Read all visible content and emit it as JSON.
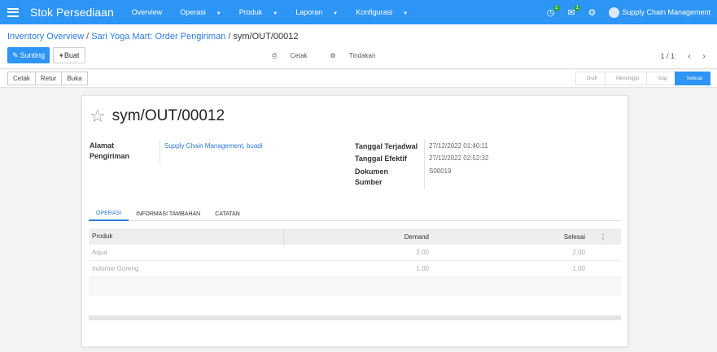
{
  "navbar": {
    "brand": "Stok Persediaan",
    "menu": [
      {
        "label": "Overview",
        "dropdown": false
      },
      {
        "label": "Operasi",
        "dropdown": true
      },
      {
        "label": "Produk",
        "dropdown": true
      },
      {
        "label": "Laporan",
        "dropdown": true
      },
      {
        "label": "Konfigurasi",
        "dropdown": true
      }
    ],
    "activity_badge": "1",
    "messages_badge": "1",
    "company": "Supply Chain Management"
  },
  "breadcrumb": {
    "item1": "Inventory Overview",
    "item2": "Sari Yoga Mart: Order Pengiriman",
    "current": "sym/OUT/00012",
    "separator": "/"
  },
  "toolbar": {
    "edit_label": "Sunting",
    "create_label": "Buat",
    "print_label": "Cetak",
    "action_label": "Tindakan"
  },
  "pager": {
    "value": "1 / 1"
  },
  "statusbar": {
    "buttons": [
      "Cetak",
      "Retur",
      "Buka"
    ],
    "stages": [
      "Draft",
      "Menunggu",
      "Siap",
      "Selesai"
    ],
    "current_stage": "Selesai"
  },
  "record": {
    "name": "sym/OUT/00012",
    "address_label_1": "Alamat",
    "address_label_2": "Pengiriman",
    "address_value": "Supply Chain Management, buadi",
    "scheduled_label": "Tanggal Terjadwal",
    "scheduled_value": "27/12/2022 01:40:11",
    "effective_label": "Tanggal Efektif",
    "effective_value": "27/12/2022 02:52:32",
    "source_label_1": "Dokumen",
    "source_label_2": "Sumber",
    "source_value": "S00019"
  },
  "tabs": [
    "OPERASI",
    "INFORMASI TAMBAHAN",
    "CATATAN"
  ],
  "table": {
    "headers": [
      "Produk",
      "Demand",
      "Selesai"
    ],
    "rows": [
      [
        "Aqua",
        "2.00",
        "2.00"
      ],
      [
        "Indomie Goreng",
        "1.00",
        "1.00"
      ]
    ]
  },
  "colors": {
    "primary": "#2c95f5",
    "link": "#2c7be5"
  }
}
